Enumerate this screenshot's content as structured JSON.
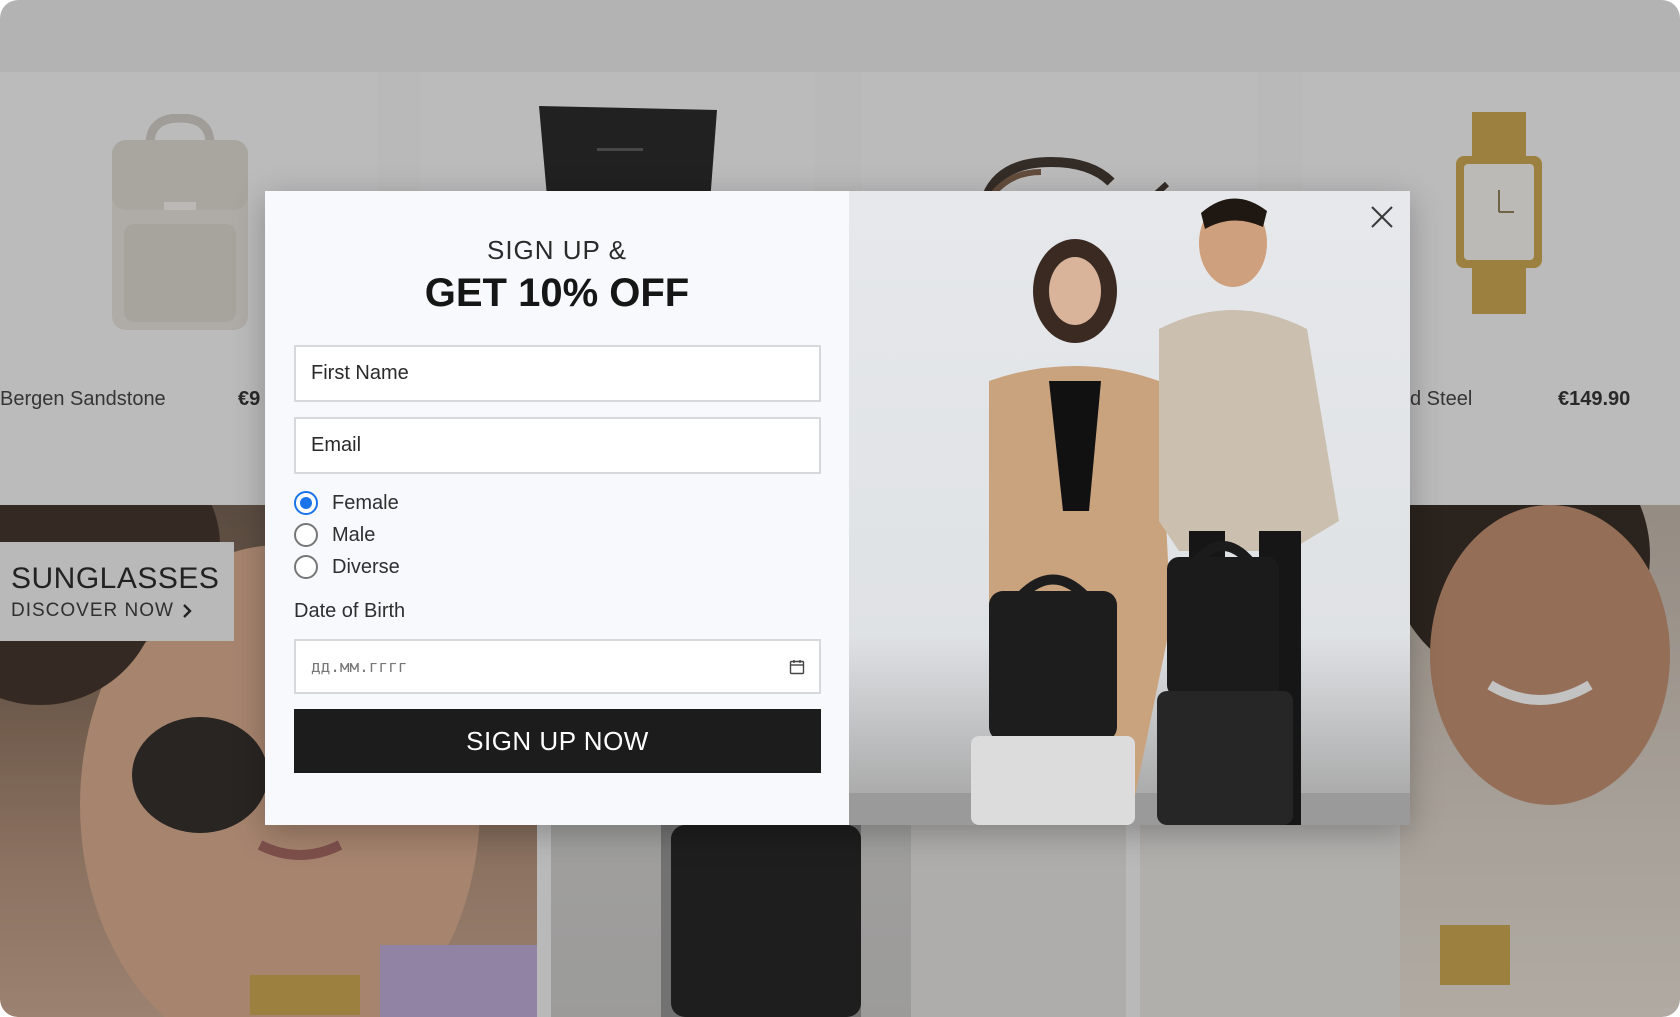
{
  "storefront": {
    "products": [
      {
        "name": "Bergen Sandstone",
        "price": "€9"
      },
      {
        "name": "d Steel",
        "price": "€149.90"
      }
    ],
    "promo_banner": {
      "title": "SUNGLASSES",
      "cta": "DISCOVER NOW",
      "cta_icon": "chevron-right-icon"
    }
  },
  "modal": {
    "headline_small": "SIGN UP &",
    "headline_big": "GET 10% OFF",
    "first_name_placeholder": "First Name",
    "email_placeholder": "Email",
    "gender_options": [
      {
        "label": "Female",
        "selected": true
      },
      {
        "label": "Male",
        "selected": false
      },
      {
        "label": "Diverse",
        "selected": false
      }
    ],
    "dob_label": "Date of Birth",
    "dob_placeholder": "дд.мм.гггг",
    "submit_label": "SIGN UP NOW",
    "close_icon": "close-icon",
    "calendar_icon": "calendar-icon"
  },
  "colors": {
    "radio_accent": "#1a73e8",
    "button_bg": "#1c1c1c",
    "form_bg": "#f7f9fc"
  }
}
